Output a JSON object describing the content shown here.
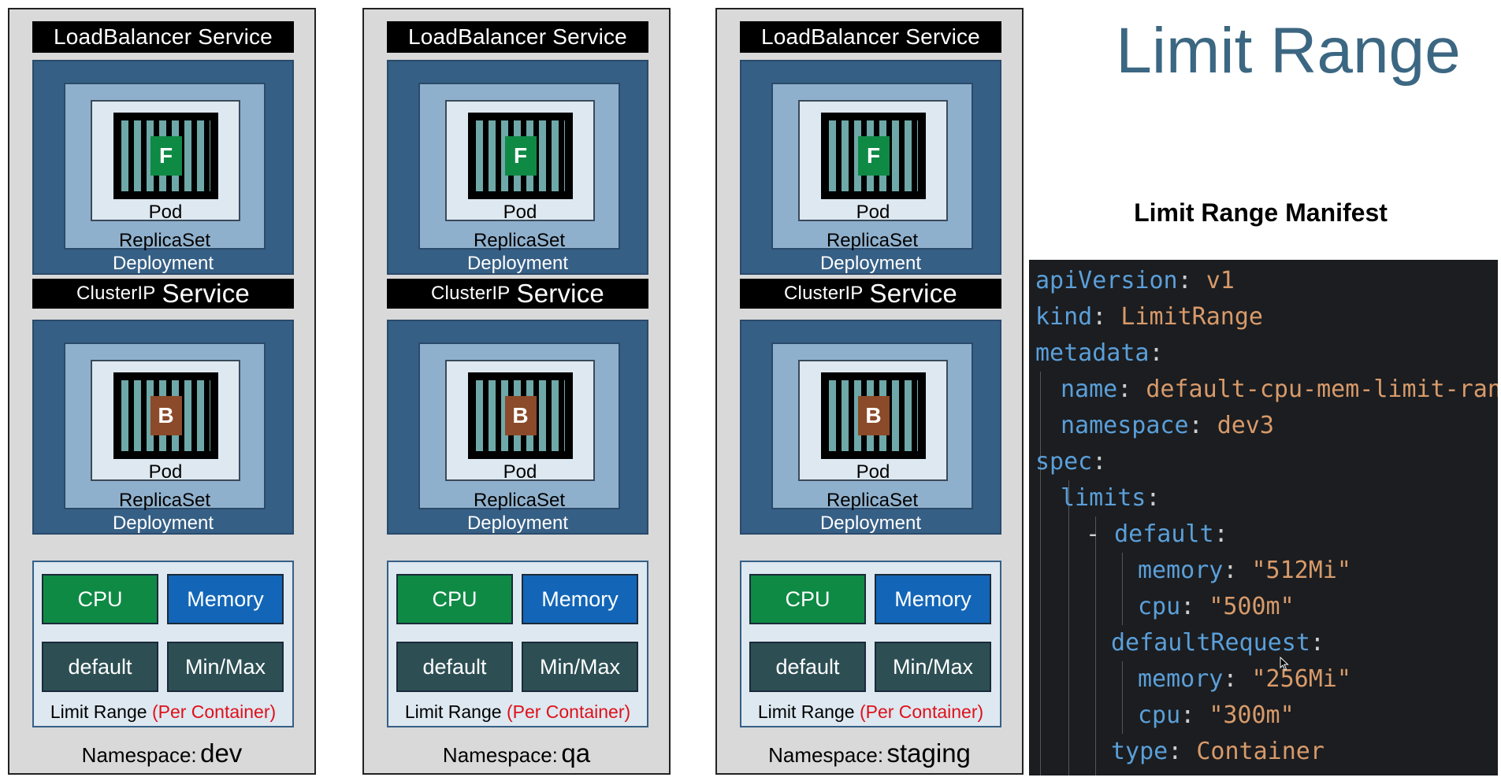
{
  "namespaces": [
    {
      "lb_service": "LoadBalancer Service",
      "cluster_small": "ClusterIP",
      "cluster_big": "Service",
      "front_glyph": "F",
      "back_glyph": "B",
      "pod": "Pod",
      "replicaset": "ReplicaSet",
      "deployment": "Deployment",
      "cpu": "CPU",
      "memory": "Memory",
      "default": "default",
      "minmax": "Min/Max",
      "limit_range": "Limit Range",
      "per_container": "(Per Container)",
      "ns_key": "Namespace:",
      "ns_value": "dev"
    },
    {
      "lb_service": "LoadBalancer Service",
      "cluster_small": "ClusterIP",
      "cluster_big": "Service",
      "front_glyph": "F",
      "back_glyph": "B",
      "pod": "Pod",
      "replicaset": "ReplicaSet",
      "deployment": "Deployment",
      "cpu": "CPU",
      "memory": "Memory",
      "default": "default",
      "minmax": "Min/Max",
      "limit_range": "Limit Range",
      "per_container": "(Per Container)",
      "ns_key": "Namespace:",
      "ns_value": "qa"
    },
    {
      "lb_service": "LoadBalancer Service",
      "cluster_small": "ClusterIP",
      "cluster_big": "Service",
      "front_glyph": "F",
      "back_glyph": "B",
      "pod": "Pod",
      "replicaset": "ReplicaSet",
      "deployment": "Deployment",
      "cpu": "CPU",
      "memory": "Memory",
      "default": "default",
      "minmax": "Min/Max",
      "limit_range": "Limit Range",
      "per_container": "(Per Container)",
      "ns_key": "Namespace:",
      "ns_value": "staging"
    }
  ],
  "title": "Limit Range",
  "manifest_title": "Limit Range Manifest",
  "manifest": {
    "l1_key": "apiVersion",
    "l1_val": "v1",
    "l2_key": "kind",
    "l2_val": "LimitRange",
    "l3_key": "metadata",
    "l4_key": "name",
    "l4_val": "default-cpu-mem-limit-range",
    "l5_key": "namespace",
    "l5_val": "dev3",
    "l6_key": "spec",
    "l7_key": "limits",
    "l8_dash": "- ",
    "l8_key": "default",
    "l9_key": "memory",
    "l9_val": "\"512Mi\"",
    "l10_key": "cpu",
    "l10_val": "\"500m\"",
    "l11_key": "defaultRequest",
    "l12_key": "memory",
    "l12_val": "\"256Mi\"",
    "l13_key": "cpu",
    "l13_val": "\"300m\"",
    "l14_key": "type",
    "l14_val": "Container"
  },
  "colors": {
    "title": "#3c6782",
    "code_bg": "#1b1d20",
    "code_key": "#5b9fd9",
    "code_value": "#d89a6a",
    "cpu": "#0f8a45",
    "memory": "#1366b7",
    "per_container": "#e0101a"
  },
  "icons": {
    "frontend": "container-frontend-icon",
    "backend": "container-backend-icon",
    "cursor": "mouse-pointer-icon"
  }
}
